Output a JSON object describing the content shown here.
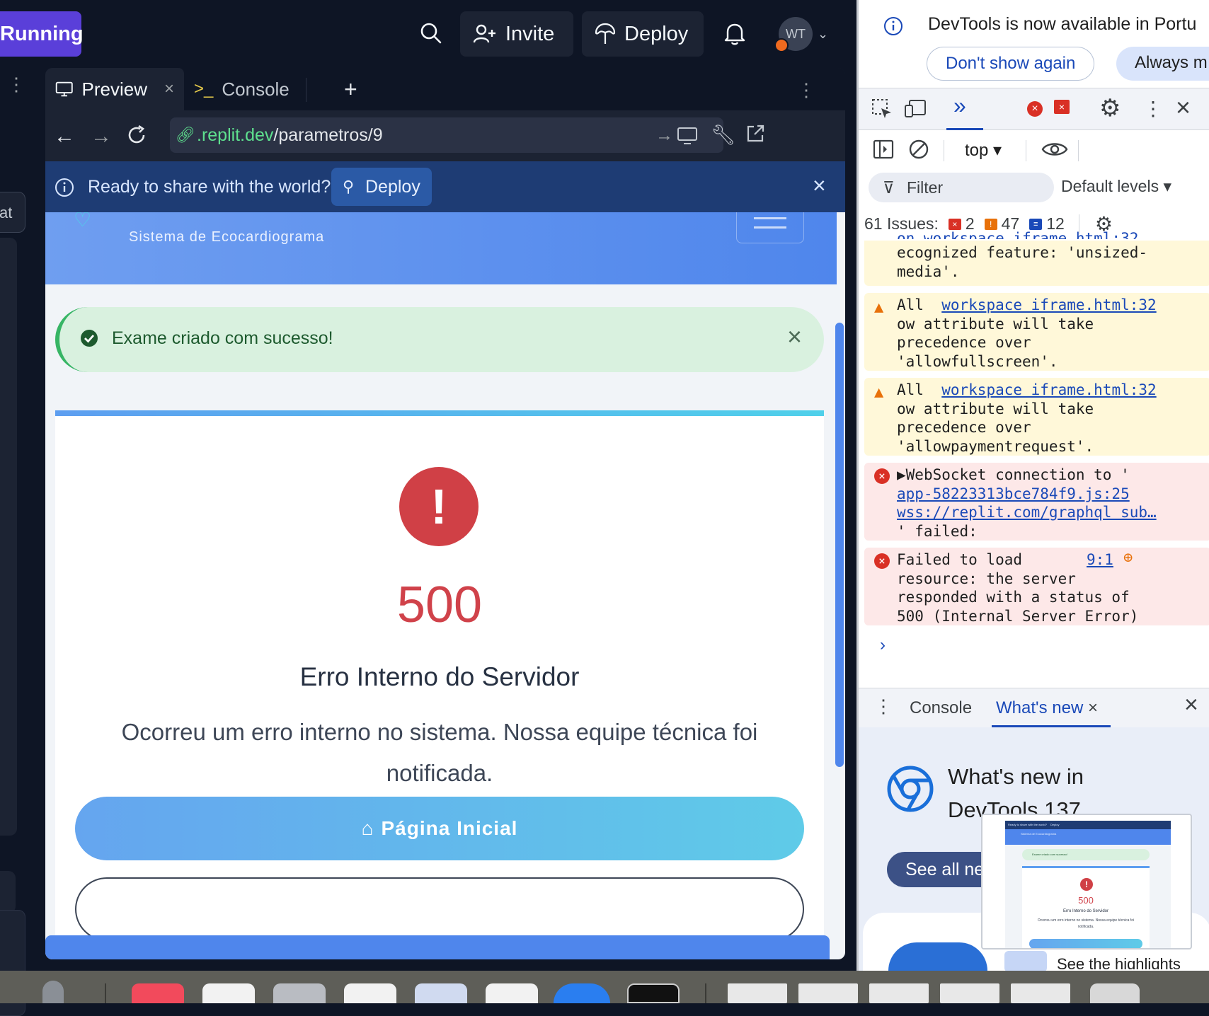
{
  "topbar": {
    "run_label": "Running",
    "invite_label": "Invite",
    "deploy_label": "Deploy",
    "avatar_initials": "WT"
  },
  "left_strip": {
    "pill_text": "at"
  },
  "tabs": {
    "preview_label": "Preview",
    "console_label": "Console"
  },
  "url": {
    "domain": ".replit.dev",
    "path": "/parametros/9"
  },
  "banner": {
    "text": "Ready to share with the world?",
    "deploy_label": "Deploy"
  },
  "site": {
    "subtitle": "Sistema de Ecocardiograma",
    "alert_text": "Exame criado com sucesso!",
    "error_code": "500",
    "error_title": "Erro Interno do Servidor",
    "error_message": "Ocorreu um erro interno no sistema. Nossa equipe técnica foi notificada.",
    "home_label": "Página Inicial"
  },
  "devtools": {
    "info_text": "DevTools is now available in Portu",
    "dont_show_label": "Don't show again",
    "always_label": "Always m",
    "context_label": "top",
    "filter_label": "Filter",
    "levels_label": "Default levels",
    "issues_label": "61 Issues:",
    "issues_errors": "2",
    "issues_warnings": "47",
    "issues_info": "12",
    "logs": [
      {
        "type": "warn",
        "lines": [
          "ecognized feature: 'unsized-",
          "media'."
        ],
        "partial_top": "on  workspace iframe.html:32"
      },
      {
        "type": "warn",
        "prefix": "All",
        "link": "workspace iframe.html:32",
        "lines": [
          "ow attribute will take",
          "precedence over",
          "'allowfullscreen'."
        ]
      },
      {
        "type": "warn",
        "prefix": "All",
        "link": "workspace iframe.html:32",
        "lines": [
          "ow attribute will take",
          "precedence over",
          "'allowpaymentrequest'."
        ]
      },
      {
        "type": "error",
        "prefix": "WebSocket connection to '",
        "link": " app-58223313bce784f9.js:25",
        "link2": "wss://replit.com/graphql sub…",
        "lines": [
          "' failed:"
        ]
      },
      {
        "type": "error",
        "prefix": "Failed to load",
        "link": "9:1",
        "lines": [
          "resource: the server",
          "responded with a status of",
          "500 (Internal Server Error)"
        ]
      }
    ],
    "bottom_console_label": "Console",
    "bottom_whatsnew_label": "What's new",
    "whatsnew_title": "What's new in DevTools 137",
    "see_all_label": "See all ne",
    "highlight_text": "See the highlights"
  },
  "thumbnail": {
    "banner_text": "Ready to share with the world?",
    "deploy_label": "Deploy",
    "subtitle": "Sistema de Ecocardiograma",
    "alert_text": "Exame criado com sucesso!",
    "error_code": "500",
    "error_title": "Erro Interno do Servidor",
    "error_message": "Ocorreu um erro interno no sistema. Nossa equipe técnica foi notificada."
  },
  "colors": {
    "replit_bg": "#0e1525",
    "run_button": "#5a3fd9",
    "error_red": "#d0424a",
    "success_green": "#37b565",
    "brand_blue": "#4f86ec"
  }
}
